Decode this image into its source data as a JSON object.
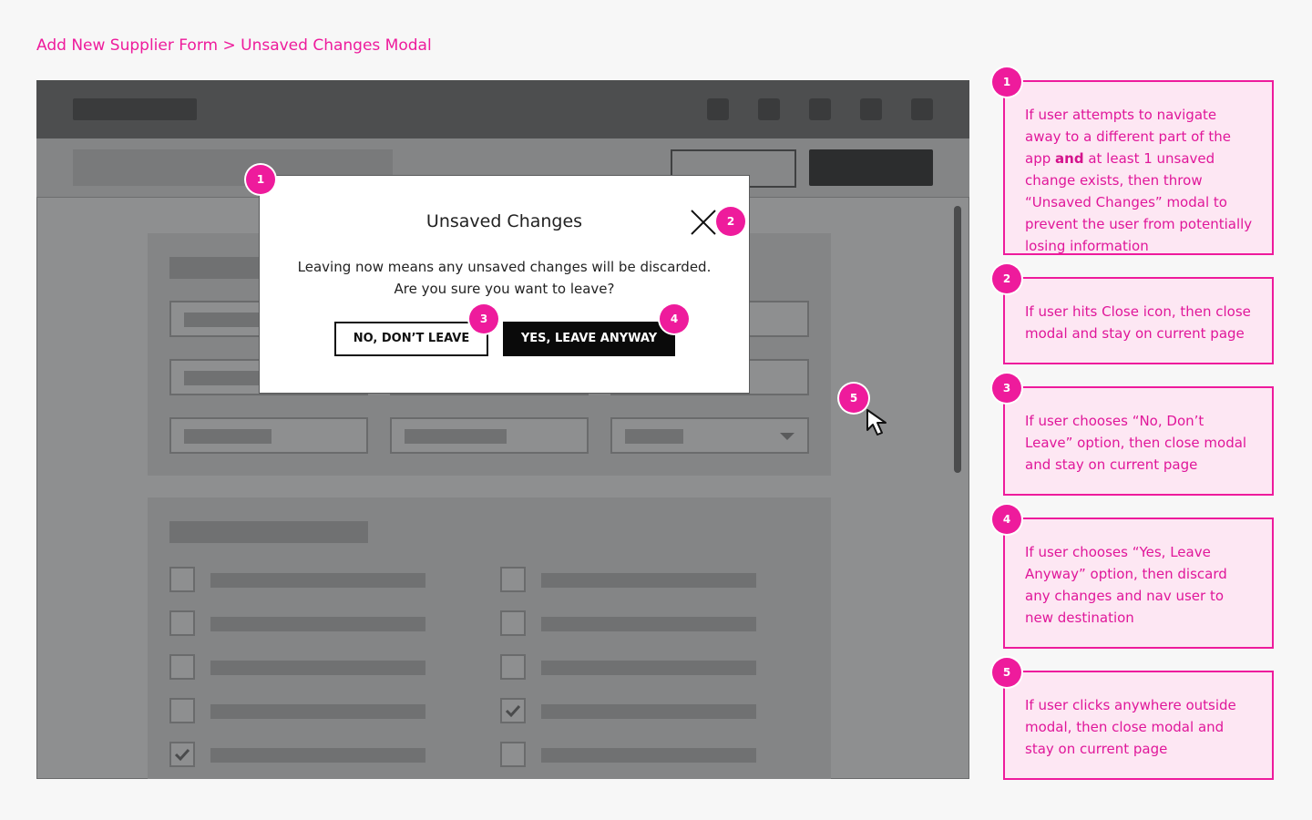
{
  "page": {
    "title": "Add New Supplier Form > Unsaved Changes Modal"
  },
  "modal": {
    "title": "Unsaved Changes",
    "body_line1": "Leaving now means any unsaved changes will be discarded.",
    "body_line2": "Are you sure you want to leave?",
    "no_button": "NO, DON’T LEAVE",
    "yes_button": "YES, LEAVE ANYWAY",
    "close_icon": "close-icon"
  },
  "badges": [
    "1",
    "2",
    "3",
    "4",
    "5"
  ],
  "checkboxes": {
    "left": [
      false,
      false,
      false,
      false,
      true
    ],
    "right": [
      false,
      false,
      false,
      true,
      false
    ]
  },
  "notes": [
    {
      "num": "1",
      "pre": "If user attempts to navigate away to a different part of the app ",
      "bold": "and",
      "post": " at least 1 unsaved change exists, then throw “Unsaved Changes” modal to prevent the user from potentially losing information"
    },
    {
      "num": "2",
      "pre": "If user hits Close icon, then close modal and stay on current page",
      "bold": "",
      "post": ""
    },
    {
      "num": "3",
      "pre": "If user chooses “No, Don’t Leave” option, then close modal and stay on current page",
      "bold": "",
      "post": ""
    },
    {
      "num": "4",
      "pre": "If user chooses “Yes, Leave Anyway” option, then discard any changes and nav user to new destination",
      "bold": "",
      "post": ""
    },
    {
      "num": "5",
      "pre": "If user clicks anywhere outside modal, then close modal and stay on current page",
      "bold": "",
      "post": ""
    }
  ],
  "colors": {
    "accent": "#ee1b9c",
    "note_bg": "#fde7f3",
    "overlay": "#8e8f90"
  }
}
